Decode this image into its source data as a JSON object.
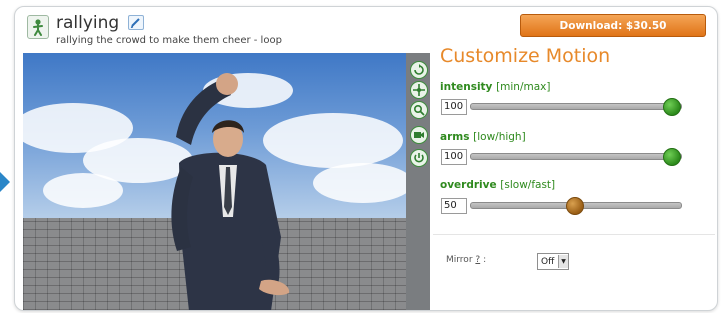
{
  "header": {
    "title": "rallying",
    "subtitle": "rallying the crowd to make them cheer - loop",
    "download_label": "Download: $30.50",
    "title_icon": "person-motion-icon",
    "edit_icon": "edit-icon"
  },
  "viewer": {
    "toolbar_icons": [
      "rotate-icon",
      "move-icon",
      "zoom-icon",
      "camera-icon",
      "reset-icon"
    ]
  },
  "customize": {
    "title": "Customize Motion",
    "params": [
      {
        "name": "intensity",
        "range": "[min/max]",
        "value": "100",
        "level": 1.0
      },
      {
        "name": "arms",
        "range": "[low/high]",
        "value": "100",
        "level": 1.0
      },
      {
        "name": "overdrive",
        "range": "[slow/fast]",
        "value": "50",
        "level": 0.5
      }
    ],
    "mirror_label": "Mirror",
    "mirror_help": "?",
    "mirror_colon": ":",
    "mirror_value": "Off"
  },
  "colors": {
    "accent_orange": "#e7892a",
    "label_green": "#2f8a1e",
    "download_bg": "#e07417"
  }
}
